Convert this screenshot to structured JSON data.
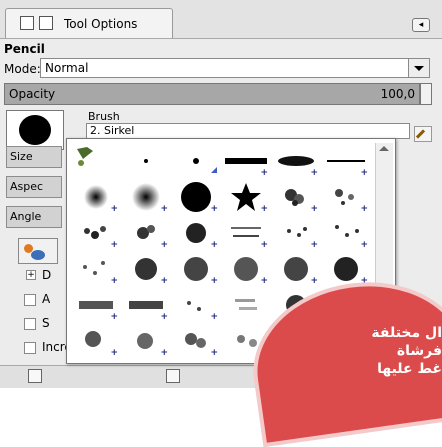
{
  "tab": {
    "label": "Tool Options"
  },
  "tool": {
    "title": "Pencil"
  },
  "mode": {
    "label": "Mode:",
    "value": "Normal"
  },
  "opacity": {
    "label": "Opacity",
    "value": "100,0"
  },
  "brush": {
    "label": "Brush",
    "name": "2. Sirkel"
  },
  "side_fields": {
    "size": "Size",
    "aspect": "Aspec",
    "angle": "Angle"
  },
  "dynamics": {
    "expander_text": "D"
  },
  "options": [
    {
      "label": "A"
    },
    {
      "label": "S"
    },
    {
      "label": "Incremental"
    }
  ],
  "callout": {
    "line1": "ال مختلفة",
    "line2": "فرشاة",
    "line3": "غط عليها"
  }
}
